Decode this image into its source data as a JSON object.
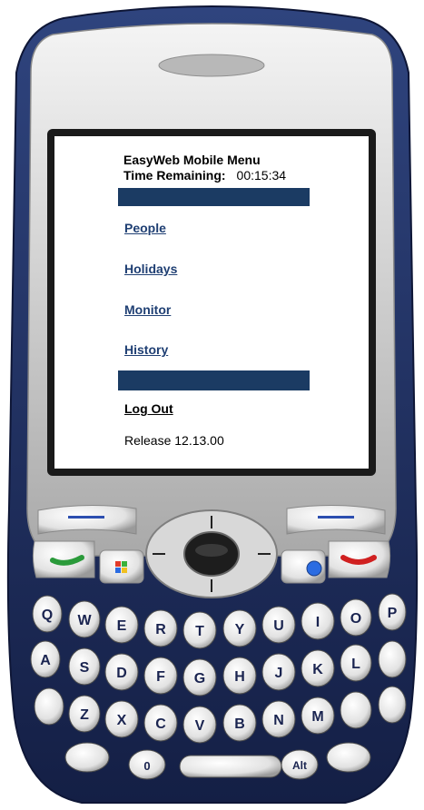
{
  "screen": {
    "title": "EasyWeb Mobile Menu",
    "time_label": "Time Remaining:",
    "time_value": "00:15:34",
    "menu": [
      {
        "label": "People"
      },
      {
        "label": "Holidays"
      },
      {
        "label": "Monitor"
      },
      {
        "label": "History"
      }
    ],
    "logout_label": "Log Out",
    "release_text": "Release 12.13.00"
  },
  "keyboard": {
    "row1": [
      "Q",
      "W",
      "E",
      "R",
      "T",
      "Y",
      "U",
      "I",
      "O",
      "P"
    ],
    "row2": [
      "A",
      "S",
      "D",
      "F",
      "G",
      "H",
      "J",
      "K",
      "L"
    ],
    "row3": [
      "Z",
      "X",
      "C",
      "V",
      "B",
      "N",
      "M"
    ],
    "bottom": [
      "0",
      "Alt"
    ]
  },
  "colors": {
    "accent_bar": "#1b3b63",
    "link": "#1f3f73",
    "phone_body": "#23346a",
    "bezel": "#c9c9c9",
    "call_green": "#2a9a3a",
    "end_red": "#d02020"
  },
  "icons": {
    "call": "phone-green-icon",
    "end": "phone-red-icon",
    "start": "windows-start-icon",
    "ok": "ok-icon"
  }
}
